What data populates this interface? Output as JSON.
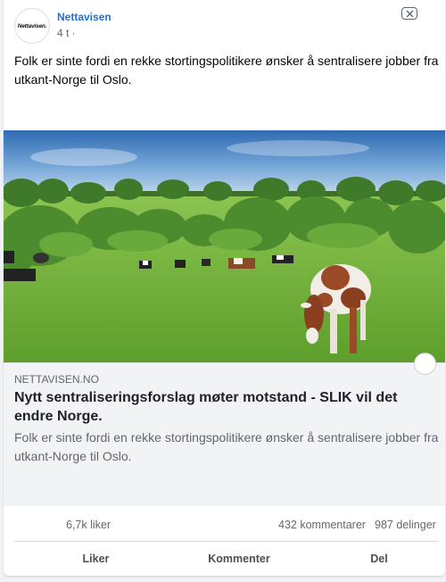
{
  "post": {
    "page_name": "Nettavisen",
    "avatar_text": "Nettavisen.",
    "time": "4 t ·",
    "text": "Folk er sinte fordi en rekke stortingspolitikere ønsker å sentralisere jobber fra utkant-Norge til Oslo."
  },
  "link": {
    "domain": "NETTAVISEN.NO",
    "title": "Nytt sentraliseringsforslag møter motstand - SLIK vil det endre Norge.",
    "description": "Folk er sinte fordi en rekke stortingspolitikere ønsker å sentralisere jobber fra utkant-Norge til Oslo."
  },
  "stats": {
    "likes": "6,7k liker",
    "comments": "432 kommentarer",
    "shares": "987 delinger"
  },
  "actions": {
    "like": "Liker",
    "comment": "Kommenter",
    "share": "Del"
  },
  "icons": {
    "close": "close-icon",
    "options": "circle-options-icon"
  },
  "colors": {
    "page_name": "#216fdb",
    "secondary_text": "#65676b",
    "link_box_bg": "#f2f3f5"
  }
}
